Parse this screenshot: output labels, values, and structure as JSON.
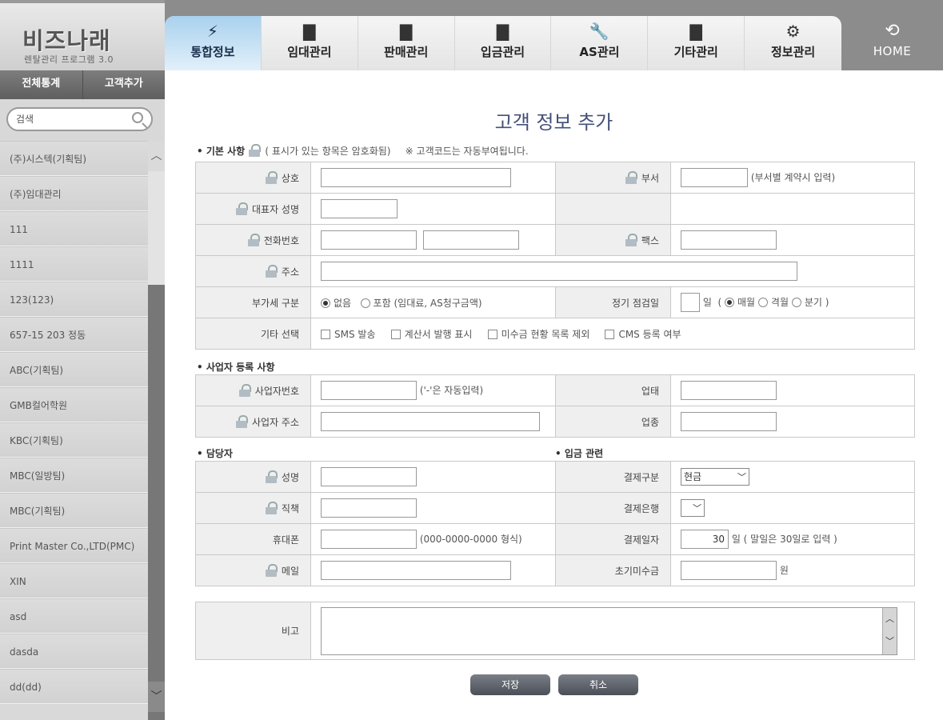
{
  "app": {
    "logo_title": "비즈나래",
    "logo_subtitle": "렌탈관리 프로그램 3.0"
  },
  "sidebar": {
    "buttons": [
      "전체통계",
      "고객추가"
    ],
    "search_value": "검색",
    "customers": [
      "(주)시스텍(기획팀)",
      "(주)임대관리",
      "111",
      "1111",
      "123(123)",
      "657-15 203 정동",
      "ABC(기획팀)",
      "GMB컬어학원",
      "KBC(기획팀)",
      "MBC(일방팀)",
      "MBC(기획팀)",
      "Print Master Co.,LTD(PMC)",
      "XIN",
      "asd",
      "dasda",
      "dd(dd)"
    ]
  },
  "nav": {
    "tabs": [
      {
        "label": "통합정보",
        "icon": "⚡"
      },
      {
        "label": "임대관리",
        "icon": "▇"
      },
      {
        "label": "판매관리",
        "icon": "▇"
      },
      {
        "label": "입금관리",
        "icon": "▇"
      },
      {
        "label": "AS관리",
        "icon": "🔧"
      },
      {
        "label": "기타관리",
        "icon": "▇"
      },
      {
        "label": "정보관리",
        "icon": "⚙"
      }
    ],
    "home_label": "HOME",
    "home_icon": "⟲"
  },
  "form": {
    "title": "고객 정보 추가",
    "basic": {
      "heading": "• 기본 사항",
      "note1": "( 표시가 있는 항목은 암호화됨)",
      "note2": "※ 고객코드는 자동부여됩니다.",
      "company_label": "상호",
      "dept_label": "부서",
      "dept_hint": "(부서별 계약시 입력)",
      "ceo_label": "대표자 성명",
      "phone_label": "전화번호",
      "fax_label": "팩스",
      "address_label": "주소",
      "vat_label": "부가세 구분",
      "vat_opt1": "없음",
      "vat_opt2": "포함",
      "vat_hint": "(임대료, AS청구금액)",
      "check_label": "정기 점검일",
      "check_unit": "일",
      "check_opt1": "매월",
      "check_opt2": "격월",
      "check_opt3": "분기",
      "other_label": "기타 선택",
      "other_opts": [
        "SMS 발송",
        "계산서 발행 표시",
        "미수금 현황 목록 제외",
        "CMS 등록 여부"
      ]
    },
    "biz": {
      "heading": "• 사업자 등록 사항",
      "regno_label": "사업자번호",
      "regno_hint": "('-'은 자동입력)",
      "type_label": "업태",
      "address_label": "사업자 주소",
      "item_label": "업종"
    },
    "manager": {
      "heading": "• 담당자",
      "name_label": "성명",
      "position_label": "직책",
      "mobile_label": "휴대폰",
      "mobile_hint": "(000-0000-0000 형식)",
      "email_label": "메일"
    },
    "payment": {
      "heading": "• 입금 관련",
      "method_label": "결제구분",
      "method_value": "현금",
      "bank_label": "결제은행",
      "date_label": "결제일자",
      "date_value": "30",
      "date_hint": "일 ( 말일은 30일로 입력 )",
      "unpaid_label": "초기미수금",
      "unpaid_unit": "원"
    },
    "memo_label": "비고",
    "save_label": "저장",
    "cancel_label": "취소"
  }
}
